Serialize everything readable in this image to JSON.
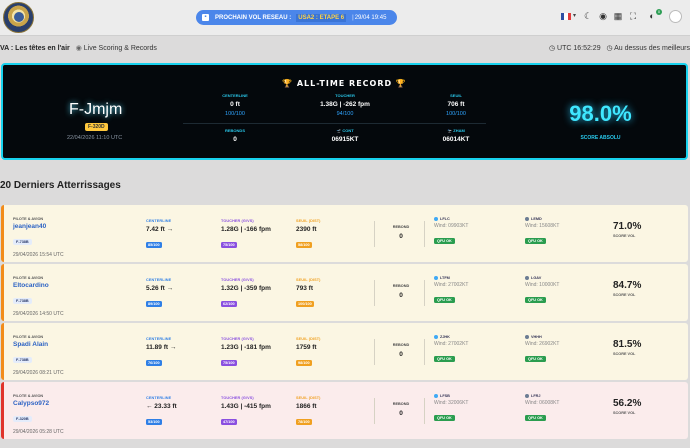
{
  "nav": {
    "next_flight_label": "PROCHAIN VOL RESEAU :",
    "stage": "USA2 : ETAPE 6",
    "separator": "|",
    "next_time": "29/04 19:45",
    "notifications_count": "0"
  },
  "bar": {
    "left_title": "VA : Les têtes en l'air",
    "section": "Live Scoring & Records",
    "utc": "UTC 16:52:29",
    "status": "Au dessus des meilleurs"
  },
  "record": {
    "title": "🏆 ALL-TIME RECORD 🏆",
    "registration": "F-Jmjm",
    "aircraft": "F-320D",
    "date": "22/04/2026 11:10 UTC",
    "stats": [
      {
        "label": "CENTERLINE",
        "value": "0 ft",
        "score": "100/100"
      },
      {
        "label": "TOUCHER",
        "value": "1.38G | -262 fpm",
        "score": "94/100"
      },
      {
        "label": "SEUIL",
        "value": "706 ft",
        "score": "100/100"
      },
      {
        "label": "REBONDS",
        "value": "0",
        "score": ""
      },
      {
        "label": "🛫 CONT",
        "value": "06915KT",
        "score": ""
      },
      {
        "label": "🛬 ZHAM",
        "value": "06014KT",
        "score": ""
      }
    ],
    "score": "98.0%",
    "score_label": "SCORE ABSOLU"
  },
  "list_title": "20 Derniers Atterrissages",
  "labels": {
    "pilot": "PILOTE & AVION",
    "centerline": "CENTERLINE",
    "toucher": "TOUCHER (G/VS)",
    "seuil": "SEUIL (DIST)",
    "rebond": "REBOND",
    "qfu": "QFU OK",
    "vol": "SCORE VOL"
  },
  "colors": {
    "centerline": "#2f7fe6",
    "toucher": "#8a4fe0",
    "seuil": "#f0a020",
    "dep_icon": "#3fa9f5",
    "arr_icon": "#6b7c93"
  },
  "landings": [
    {
      "pilot": "jeanjean40",
      "aircraft": "F-738B",
      "date": "29/04/2026 15:54 UTC",
      "centerline": "7.42 ft →",
      "centerline_score": "85/100",
      "toucher": "1.28G | -166 fpm",
      "toucher_score": "75/100",
      "seuil": "2390 ft",
      "seuil_score": "58/100",
      "rebond": "0",
      "dep_code": "LFLC",
      "dep_wind": "Wind: 09903KT",
      "arr_code": "LEMD",
      "arr_wind": "Wind: 15608KT",
      "score": "71.0%",
      "accent": "#f28c1a",
      "bg": "#fbf6e3"
    },
    {
      "pilot": "Eltocardino",
      "aircraft": "F-738B",
      "date": "29/04/2026 14:50 UTC",
      "centerline": "5.26 ft →",
      "centerline_score": "89/100",
      "toucher": "1.32G | -359 fpm",
      "toucher_score": "62/100",
      "seuil": "793 ft",
      "seuil_score": "100/100",
      "rebond": "0",
      "dep_code": "LTFM",
      "dep_wind": "Wind: 27002KT",
      "arr_code": "LGAV",
      "arr_wind": "Wind: 10000KT",
      "score": "84.7%",
      "accent": "#f28c1a",
      "bg": "#fbf6e3"
    },
    {
      "pilot": "Spadi Alain",
      "aircraft": "F-738B",
      "date": "29/04/2026 08:21 UTC",
      "centerline": "11.89 ft →",
      "centerline_score": "76/100",
      "toucher": "1.23G | -181 fpm",
      "toucher_score": "75/100",
      "seuil": "1759 ft",
      "seuil_score": "98/100",
      "rebond": "0",
      "dep_code": "ZJHK",
      "dep_wind": "Wind: 27002KT",
      "arr_code": "VHHH",
      "arr_wind": "Wind: 26902KT",
      "score": "81.5%",
      "accent": "#f28c1a",
      "bg": "#fbf6e3"
    },
    {
      "pilot": "Calypso972",
      "aircraft": "F-320B",
      "date": "29/04/2026 05:28 UTC",
      "centerline": "← 23.33 ft",
      "centerline_score": "53/100",
      "toucher": "1.43G | -415 fpm",
      "toucher_score": "47/100",
      "seuil": "1866 ft",
      "seuil_score": "78/100",
      "rebond": "0",
      "dep_code": "LFSB",
      "dep_wind": "Wind: 32006KT",
      "arr_code": "LFRJ",
      "arr_wind": "Wind: 06008KT",
      "score": "56.2%",
      "accent": "#e0342b",
      "bg": "#fbecec"
    }
  ]
}
